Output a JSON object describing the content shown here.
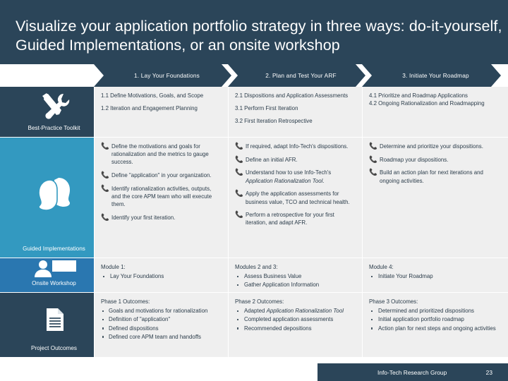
{
  "slide": {
    "title": "Visualize your application portfolio strategy in three ways:   do-it-yourself, Guided Implementations, or an onsite workshop",
    "accent_navy": "#2b4559",
    "accent_cyan": "#3399c0",
    "accent_blue": "#2a77b0",
    "cell_bg": "#efefef"
  },
  "phases": [
    {
      "label": "1. Lay Your Foundations"
    },
    {
      "label": "2. Plan and Test Your ARF"
    },
    {
      "label": "3. Initiate Your Roadmap"
    }
  ],
  "sidebar": [
    {
      "label": "Best-Practice Toolkit",
      "icon": "tools-icon",
      "color": "#2b4559"
    },
    {
      "label": "Guided Implementations",
      "icon": "two-heads-icon",
      "color": "#3399c0"
    },
    {
      "label": "Onsite Workshop",
      "icon": "presenter-whiteboard-icon",
      "color": "#2a77b0"
    },
    {
      "label": "Project Outcomes",
      "icon": "document-icon",
      "color": "#2b4559"
    }
  ],
  "rows": {
    "toolkit": [
      {
        "lines": [
          "1.1 Define Motivations, Goals, and Scope",
          "1.2 Iteration and Engagement Planning"
        ]
      },
      {
        "lines": [
          "2.1 Dispositions and Application Assessments",
          "3.1 Perform First Iteration",
          "3.2 First Iteration Retrospective"
        ]
      },
      {
        "lines": [
          "4.1 Prioritize and Roadmap Applications",
          "4.2 Ongoing Rationalization and Roadmapping"
        ]
      }
    ],
    "guided": [
      {
        "items": [
          {
            "text": "Define the motivations and goals for rationalization and the metrics to gauge success."
          },
          {
            "text": "Define \"application\" in your organization."
          },
          {
            "text": "Identify rationalization activities, outputs, and the core APM team who will execute them."
          },
          {
            "text": "Identify your first iteration."
          }
        ]
      },
      {
        "items": [
          {
            "text": "If required, adapt Info-Tech's dispositions."
          },
          {
            "text": "Define an initial AFR."
          },
          {
            "text": "Understand how to use Info-Tech's ",
            "italic": "Application Rationalization Tool",
            "after": "."
          },
          {
            "text": "Apply the application assessments for business value, TCO and technical health."
          },
          {
            "text": "Perform a retrospective for your first iteration, and adapt AFR."
          }
        ]
      },
      {
        "items": [
          {
            "text": "Determine and prioritize your dispositions."
          },
          {
            "text": "Roadmap your dispositions."
          },
          {
            "text": "Build an action plan for next iterations and ongoing activities."
          }
        ]
      }
    ],
    "workshop": [
      {
        "heading": "Module 1:",
        "items": [
          "Lay Your Foundations"
        ]
      },
      {
        "heading": "Modules 2 and 3:",
        "items": [
          "Assess Business Value",
          "Gather Application Information"
        ]
      },
      {
        "heading": "Module 4:",
        "items": [
          "Initiate Your Roadmap"
        ]
      }
    ],
    "outcomes": [
      {
        "heading": "Phase 1 Outcomes:",
        "items": [
          {
            "text": "Goals and motivations for rationalization"
          },
          {
            "text": "Definition of \"application\""
          },
          {
            "text": "Defined dispositions"
          },
          {
            "text": "Defined core APM team and handoffs"
          }
        ]
      },
      {
        "heading": "Phase 2 Outcomes:",
        "items": [
          {
            "text": "Adapted ",
            "italic": "Application Rationalization Tool"
          },
          {
            "text": "Completed application assessments"
          },
          {
            "text": "Recommended depositions"
          }
        ]
      },
      {
        "heading": "Phase 3 Outcomes:",
        "items": [
          {
            "text": "Determined and prioritized dispositions"
          },
          {
            "text": "Initial application portfolio roadmap"
          },
          {
            "text": "Action plan for next steps and ongoing activities"
          }
        ]
      }
    ]
  },
  "footer": {
    "name": "Info-Tech Research Group",
    "page": "23"
  }
}
